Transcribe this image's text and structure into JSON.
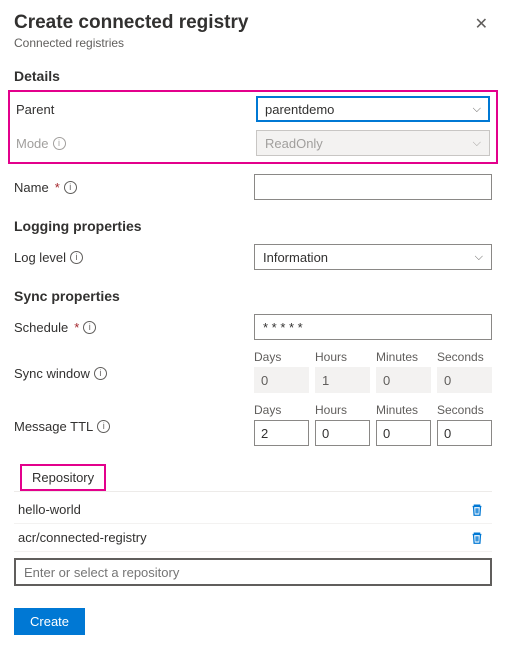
{
  "header": {
    "title": "Create connected registry",
    "subtitle": "Connected registries"
  },
  "sections": {
    "details": "Details",
    "logging": "Logging properties",
    "sync": "Sync properties",
    "repository_tab": "Repository"
  },
  "fields": {
    "parent": {
      "label": "Parent",
      "value": "parentdemo"
    },
    "mode": {
      "label": "Mode",
      "value": "ReadOnly"
    },
    "name": {
      "label": "Name",
      "value": ""
    },
    "log_level": {
      "label": "Log level",
      "value": "Information"
    },
    "schedule": {
      "label": "Schedule",
      "value": "* * * * *"
    },
    "sync_window": {
      "label": "Sync window",
      "units": {
        "days": "Days",
        "hours": "Hours",
        "minutes": "Minutes",
        "seconds": "Seconds"
      },
      "values": {
        "days": "0",
        "hours": "1",
        "minutes": "0",
        "seconds": "0"
      }
    },
    "message_ttl": {
      "label": "Message TTL",
      "units": {
        "days": "Days",
        "hours": "Hours",
        "minutes": "Minutes",
        "seconds": "Seconds"
      },
      "values": {
        "days": "2",
        "hours": "0",
        "minutes": "0",
        "seconds": "0"
      }
    }
  },
  "repositories": {
    "items": [
      "hello-world",
      "acr/connected-registry"
    ],
    "placeholder": "Enter or select a repository"
  },
  "footer": {
    "create": "Create"
  }
}
